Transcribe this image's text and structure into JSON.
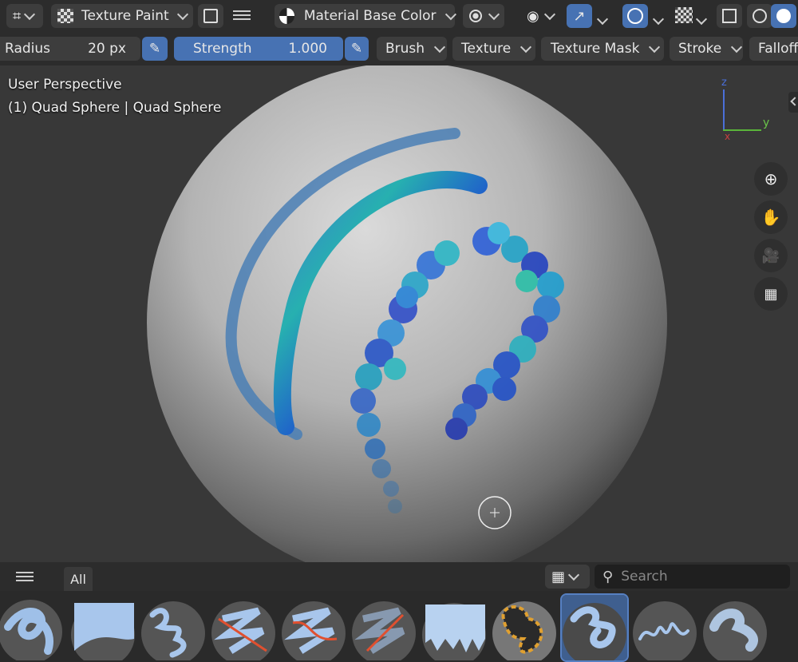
{
  "toolbar": {
    "mode_label": "Texture Paint",
    "shading_label": "Material Base Color",
    "icons": [
      "editor-type-icon",
      "texture-paint-icon",
      "view-toggle-icon",
      "menu-icon",
      "material-sphere-icon",
      "dot-icon",
      "visibility-eye-icon",
      "gizmo-icon",
      "overlay-icon",
      "checker-icon",
      "xray-icon",
      "wireframe-shading-icon",
      "solid-shading-icon"
    ]
  },
  "tool_settings": {
    "radius_label": "Radius",
    "radius_value": "20 px",
    "strength_label": "Strength",
    "strength_value": "1.000",
    "brush_label": "Brush",
    "texture_label": "Texture",
    "texture_mask_label": "Texture Mask",
    "stroke_label": "Stroke",
    "falloff_label": "Falloff"
  },
  "viewport": {
    "view_name": "User Perspective",
    "object_info": "(1) Quad Sphere | Quad Sphere",
    "axes": {
      "z": "z",
      "y": "y",
      "x": "x"
    },
    "nav_icons": [
      "zoom-icon",
      "pan-hand-icon",
      "camera-icon",
      "ortho-grid-icon"
    ]
  },
  "asset_shelf": {
    "tab_all": "All",
    "search_placeholder": "Search",
    "brushes": [
      "brush-1",
      "brush-2",
      "brush-3",
      "brush-4",
      "brush-5",
      "brush-6",
      "brush-7",
      "brush-8",
      "brush-9",
      "brush-10",
      "brush-11"
    ],
    "active_index": 8
  },
  "colors": {
    "accent": "#4772b3",
    "bg": "#2c2c2c",
    "viewport": "#383838"
  }
}
